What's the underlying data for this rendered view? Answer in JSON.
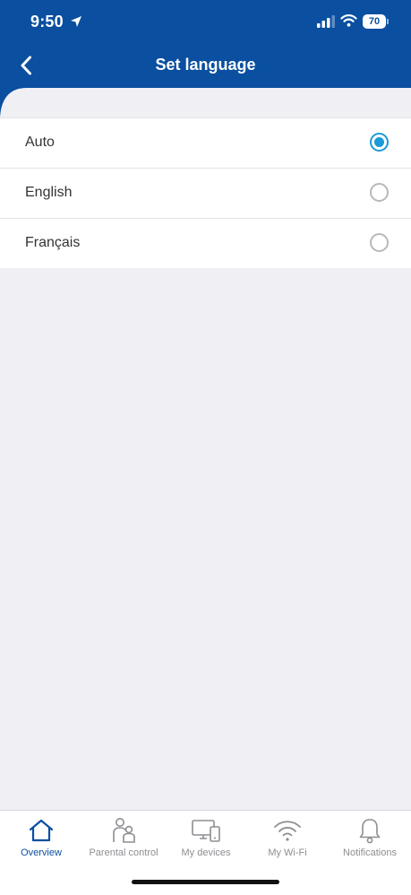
{
  "status_bar": {
    "time": "9:50",
    "battery": "70"
  },
  "header": {
    "title": "Set language"
  },
  "languages": [
    {
      "label": "Auto",
      "selected": true
    },
    {
      "label": "English",
      "selected": false
    },
    {
      "label": "Français",
      "selected": false
    }
  ],
  "tabbar": {
    "tabs": [
      {
        "label": "Overview",
        "icon": "home-icon",
        "active": true
      },
      {
        "label": "Parental control",
        "icon": "parental-control-icon",
        "active": false
      },
      {
        "label": "My devices",
        "icon": "devices-icon",
        "active": false
      },
      {
        "label": "My Wi-Fi",
        "icon": "wifi-icon",
        "active": false
      },
      {
        "label": "Notifications",
        "icon": "bell-icon",
        "active": false
      }
    ]
  },
  "colors": {
    "brand": "#0a4fa0",
    "accent": "#1a9ad6",
    "background": "#efeff4",
    "inactive": "#8e8e93"
  }
}
